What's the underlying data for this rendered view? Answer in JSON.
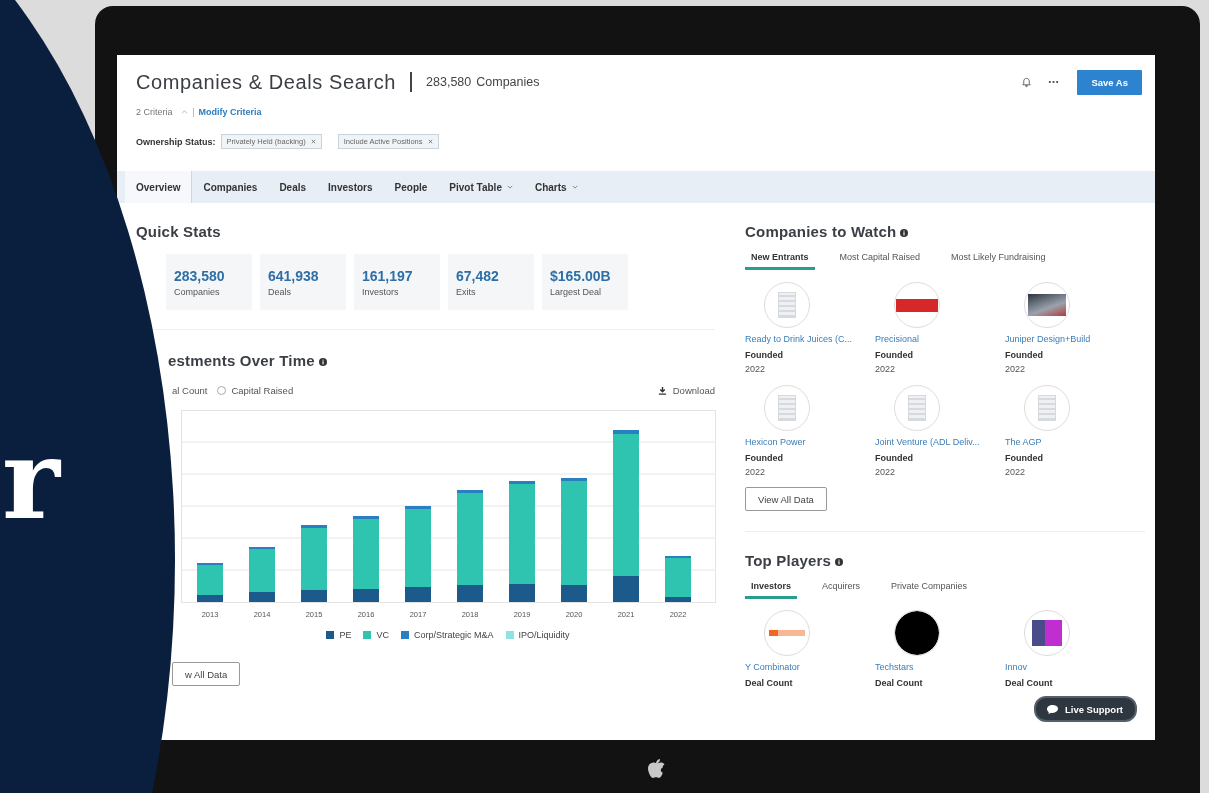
{
  "overlay": {
    "text": "r"
  },
  "header": {
    "title": "Companies & Deals Search",
    "count": "283,580",
    "count_label": "Companies",
    "criteria": "2 Criteria",
    "modify": "Modify Criteria",
    "save": "Save As"
  },
  "filters": {
    "label": "Ownership Status:",
    "chips": [
      "Privately Held (backing)",
      "Include Active Positions"
    ]
  },
  "tabs": [
    {
      "label": "Overview",
      "selected": true,
      "kind": "tab"
    },
    {
      "label": "Companies",
      "selected": false,
      "kind": "tab"
    },
    {
      "label": "Deals",
      "selected": false,
      "kind": "tab"
    },
    {
      "label": "Investors",
      "selected": false,
      "kind": "tab"
    },
    {
      "label": "People",
      "selected": false,
      "kind": "tab"
    },
    {
      "label": "Pivot Table",
      "selected": false,
      "kind": "dropdown"
    },
    {
      "label": "Charts",
      "selected": false,
      "kind": "dropdown"
    }
  ],
  "quick_stats": {
    "title": "Quick Stats",
    "items": [
      {
        "value": "283,580",
        "label": "Companies"
      },
      {
        "value": "641,938",
        "label": "Deals"
      },
      {
        "value": "161,197",
        "label": "Investors"
      },
      {
        "value": "67,482",
        "label": "Exits"
      },
      {
        "value": "$165.00B",
        "label": "Largest Deal"
      }
    ]
  },
  "investments": {
    "title": "estments Over Time",
    "options": [
      {
        "label": "al Count",
        "kind": "text"
      },
      {
        "label": "Capital Raised",
        "kind": "radio",
        "selected": false
      }
    ],
    "download": "Download",
    "x_labels": [
      "2013",
      "2014",
      "2015",
      "2016",
      "2017",
      "2018",
      "2019",
      "2020",
      "2021",
      "2022"
    ],
    "legend": [
      {
        "name": "PE",
        "color": "#1b5a8a"
      },
      {
        "name": "VC",
        "color": "#2ec4b0"
      },
      {
        "name": "Corp/Strategic M&A",
        "color": "#2a7fc1"
      },
      {
        "name": "IPO/Liquidity",
        "color": "#8fe3e3"
      }
    ],
    "button": "w All Data"
  },
  "watch": {
    "title": "Companies to Watch",
    "tabs": [
      {
        "label": "New Entrants",
        "selected": true
      },
      {
        "label": "Most Capital Raised",
        "selected": false
      },
      {
        "label": "Most Likely Fundraising",
        "selected": false
      }
    ],
    "items": [
      {
        "name": "Ready to Drink Juices (C...",
        "kind": "building",
        "field": "Founded",
        "value": "2022"
      },
      {
        "name": "Precisional",
        "kind": "redbanner",
        "field": "Founded",
        "value": "2022"
      },
      {
        "name": "Juniper Design+Build",
        "kind": "greyphoto",
        "field": "Founded",
        "value": "2022"
      },
      {
        "name": "Hexicon Power",
        "kind": "building",
        "field": "Founded",
        "value": "2022"
      },
      {
        "name": "Joint Venture (ADL Deliv...",
        "kind": "building",
        "field": "Founded",
        "value": "2022"
      },
      {
        "name": "The AGP",
        "kind": "building",
        "field": "Founded",
        "value": "2022"
      }
    ],
    "button": "View All Data"
  },
  "players": {
    "title": "Top Players",
    "tabs": [
      {
        "label": "Investors",
        "selected": true
      },
      {
        "label": "Acquirers",
        "selected": false
      },
      {
        "label": "Private Companies",
        "selected": false
      }
    ],
    "items": [
      {
        "name": "Y Combinator",
        "kind": "orangemark",
        "field": "Deal Count"
      },
      {
        "name": "Techstars",
        "kind": "blackdisc",
        "field": "Deal Count"
      },
      {
        "name": "Innov",
        "kind": "purpletile",
        "field": "Deal Count"
      }
    ]
  },
  "live_support": "Live Support"
}
